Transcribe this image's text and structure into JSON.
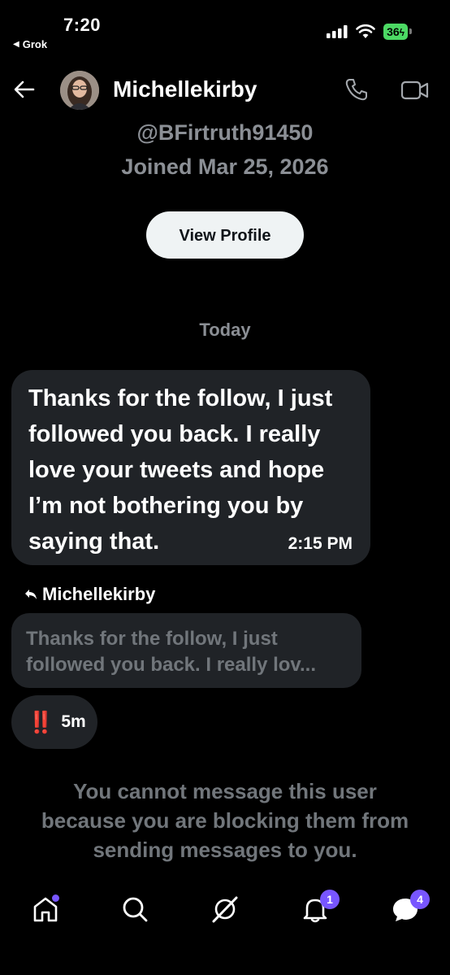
{
  "status_bar": {
    "time": "7:20",
    "back_app": "Grok",
    "battery": "36"
  },
  "header": {
    "name": "Michellekirby",
    "handle": "@BFirtruth91450",
    "joined": "Joined Mar 25, 2026",
    "view_profile_label": "View Profile"
  },
  "conversation": {
    "day_separator": "Today",
    "message": {
      "text": "Thanks for the follow, I just followed you back. I really love your tweets and hope I’m not bothering you by saying that.",
      "time": "2:15 PM"
    },
    "reply": {
      "label": "Michellekirby",
      "quote_line1": "Thanks for the follow, I  just",
      "quote_line2": "followed you back. I really lov..."
    },
    "reaction": {
      "emoji": "‼️",
      "ago": "5m"
    },
    "blocked_notice": "You cannot message this user because you are blocking them from sending messages to you."
  },
  "bottom_nav": {
    "notifications_badge": "1",
    "messages_badge": "4"
  },
  "colors": {
    "background": "#000000",
    "bubble": "#202327",
    "muted_text": "#71767b",
    "accent": "#7856ff",
    "battery": "#4cd964"
  }
}
